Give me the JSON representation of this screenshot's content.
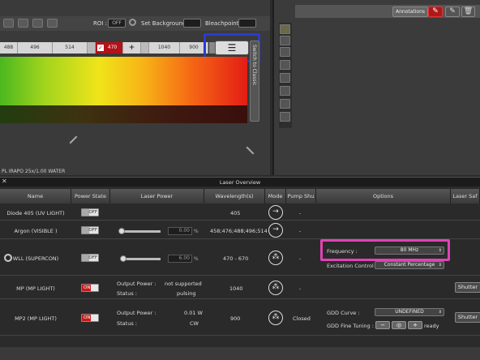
{
  "toolbar": {
    "roi_label": "ROI :",
    "roi_toggle": "OFF",
    "set_background_label": "Set Background :",
    "bleachpoint_label": "Bleachpoint :"
  },
  "laser_lines": [
    "488",
    "496",
    "514",
    "",
    "470",
    "",
    "1040",
    "900"
  ],
  "laser_line_470_checked": true,
  "side_button_label": "Switch to Classic",
  "objective_text": "PL IRAPO  25x/1.00 WATER",
  "right_panel": {
    "annotations_label": "Annotations"
  },
  "laser_overview": {
    "title": "Laser Overview",
    "columns": [
      "Name",
      "Power State",
      "Laser Power",
      "Wavelength(s)",
      "Mode",
      "Pump Shu",
      "Options",
      "Laser Saf"
    ],
    "rows": [
      {
        "name": "Diode 405 (UV LIGHT)",
        "power_state": "OFF",
        "wavelength": "405",
        "pump": "-"
      },
      {
        "name": "Argon (VISIBLE )",
        "power_state": "OFF",
        "power_value": "0.00",
        "power_unit": "%",
        "wavelength": "458;476;488;496;514",
        "pump": "-"
      },
      {
        "name": "WLL (SUPERCON)",
        "power_state": "OFF",
        "power_value": "6.00",
        "power_unit": "%",
        "wavelength": "470 - 670",
        "pump": "-",
        "frequency_label": "Frequency :",
        "frequency_value": "80 MHz",
        "excitation_label": "Excitation Control :",
        "excitation_value": "Constant Percentage"
      },
      {
        "name": "MP (MP LIGHT)",
        "power_state": "ON",
        "output_power_label": "Output Power :",
        "output_power_value": "not supported",
        "status_label": "Status :",
        "status_value": "pulsing",
        "wavelength": "1040",
        "pump": "-",
        "shutter_label": "Shutter"
      },
      {
        "name": "MP2 (MP LIGHT)",
        "power_state": "ON",
        "output_power_label": "Output Power :",
        "output_power_value": "0.01 W",
        "status_label": "Status :",
        "status_value": "CW",
        "wavelength": "900",
        "pump": "Closed",
        "gdd_curve_label": "GDD Curve :",
        "gdd_curve_value": "UNDEFINED",
        "gdd_fine_label": "GDD Fine Tuning :",
        "gdd_fine_status": "ready",
        "shutter_label": "Shutter"
      }
    ]
  },
  "colors": {
    "annotation_highlight": "#2a3bd0",
    "frequency_highlight": "#e043b4",
    "on_toggle": "#c61b1b",
    "laser_470": "#b3121a"
  }
}
